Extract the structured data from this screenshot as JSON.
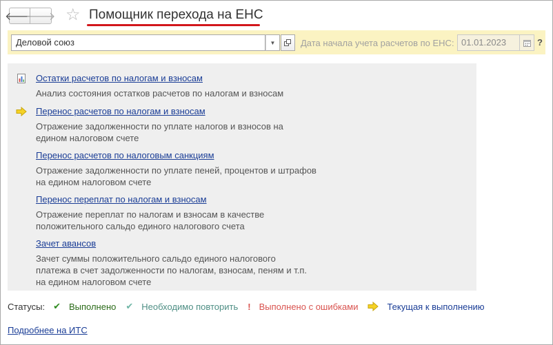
{
  "header": {
    "title": "Помощник перехода на ЕНС",
    "back_icon": "arrow-left-icon",
    "forward_icon": "arrow-right-icon",
    "favorite_icon": "star-icon"
  },
  "toolbar": {
    "organization_value": "Деловой союз",
    "date_label": "Дата начала учета расчетов по ЕНС:",
    "date_value": "01.01.2023",
    "help_label": "?"
  },
  "items": [
    {
      "icon": "report-chart-icon",
      "link": "Остатки расчетов по налогам и взносам",
      "desc_lines": [
        "Анализ состояния остатков расчетов по налогам и взносам"
      ]
    },
    {
      "icon": "current-arrow-icon",
      "link": "Перенос расчетов по налогам и взносам",
      "desc_lines": [
        "Отражение задолженности по уплате налогов и взносов на",
        "едином налоговом счете"
      ]
    },
    {
      "icon": "",
      "link": "Перенос расчетов по налоговым санкциям",
      "desc_lines": [
        "Отражение задолженности по уплате пеней, процентов и штрафов",
        "на едином налоговом счете"
      ]
    },
    {
      "icon": "",
      "link": "Перенос переплат по налогам и взносам",
      "desc_lines": [
        "Отражение переплат по налогам и взносам в качестве",
        "положительного сальдо единого налогового счета"
      ]
    },
    {
      "icon": "",
      "link": "Зачет авансов",
      "desc_lines": [
        "Зачет суммы положительного сальдо единого налогового",
        "платежа в счет задолженности по налогам, взносам, пеням и т.п.",
        "на едином налоговом счете"
      ]
    }
  ],
  "statuses": {
    "label": "Статусы:",
    "entries": [
      {
        "icon": "check-icon",
        "glyph": "✔",
        "text": "Выполнено",
        "color": "#2e8b1f",
        "text_color": "#2a6a18"
      },
      {
        "icon": "check-outline-icon",
        "glyph": "✔",
        "text": "Необходимо повторить",
        "color": "#6fb6a6",
        "text_color": "#4f8f85"
      },
      {
        "icon": "exclamation-icon",
        "glyph": "!",
        "text": "Выполнено с ошибками",
        "color": "#d9534f",
        "text_color": "#d9534f"
      },
      {
        "icon": "current-arrow-icon",
        "glyph": "➜",
        "text": "Текущая к выполнению",
        "color": "#e6c21a",
        "text_color": "#1a3d96"
      }
    ]
  },
  "footer": {
    "its_link": "Подробнее на ИТС"
  }
}
